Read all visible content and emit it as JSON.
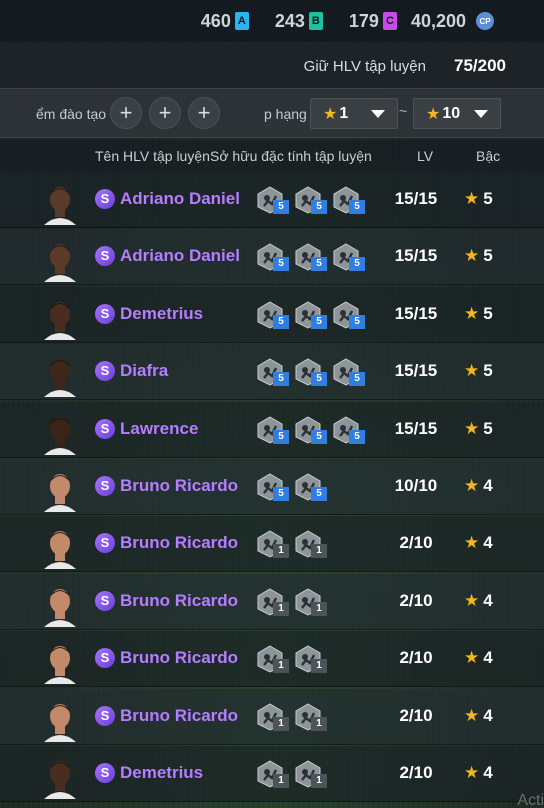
{
  "currencies": [
    {
      "value": "460",
      "badge": "A",
      "color": "#2ab5f0"
    },
    {
      "value": "243",
      "badge": "B",
      "color": "#1fc1a0"
    },
    {
      "value": "179",
      "badge": "C",
      "color": "#c94ce8"
    },
    {
      "value": "40,200",
      "badge": "CP",
      "color": "#5e8fd6"
    }
  ],
  "hold": {
    "label": "Giữ HLV tập luyện",
    "value": "75/200"
  },
  "filter": {
    "training_label": "ểm đào tạo",
    "rank_label": "p hạng",
    "rank_from": "1",
    "rank_to": "10",
    "separator": "~",
    "plus": "+"
  },
  "columns": {
    "name": "Tên HLV tập luyện",
    "traits": "Sở hữu đặc tính tập luyện",
    "lv": "LV",
    "grade": "Bậc"
  },
  "badge_letter": "S",
  "coaches": [
    {
      "name": "Adriano Daniel",
      "lv": "15/15",
      "grade": "5",
      "traits": [
        {
          "icon": "ball-control-icon",
          "level": "5"
        },
        {
          "icon": "dribble-icon",
          "level": "5"
        },
        {
          "icon": "sprint-icon",
          "level": "5"
        }
      ],
      "skin": "#5a3a28"
    },
    {
      "name": "Adriano Daniel",
      "lv": "15/15",
      "grade": "5",
      "traits": [
        {
          "icon": "tackle-icon",
          "level": "5"
        },
        {
          "icon": "dribble-icon",
          "level": "5"
        },
        {
          "icon": "header-icon",
          "level": "5"
        }
      ],
      "skin": "#5a3a28"
    },
    {
      "name": "Demetrius",
      "lv": "15/15",
      "grade": "5",
      "traits": [
        {
          "icon": "strength-icon",
          "level": "5"
        },
        {
          "icon": "stamina-icon",
          "level": "5"
        },
        {
          "icon": "jump-icon",
          "level": "5"
        }
      ],
      "skin": "#4a2d1e"
    },
    {
      "name": "Diafra",
      "lv": "15/15",
      "grade": "5",
      "traits": [
        {
          "icon": "strength-icon",
          "level": "5"
        },
        {
          "icon": "stamina-icon",
          "level": "5"
        },
        {
          "icon": "jump-icon",
          "level": "5"
        }
      ],
      "skin": "#3f261a"
    },
    {
      "name": "Lawrence",
      "lv": "15/15",
      "grade": "5",
      "traits": [
        {
          "icon": "shooting-icon",
          "level": "5"
        },
        {
          "icon": "passing-icon",
          "level": "5"
        },
        {
          "icon": "jump-icon",
          "level": "5"
        }
      ],
      "skin": "#3a2418"
    },
    {
      "name": "Bruno Ricardo",
      "lv": "10/10",
      "grade": "4",
      "traits": [
        {
          "icon": "tackle-icon",
          "level": "5"
        },
        {
          "icon": "strength-icon",
          "level": "5"
        }
      ],
      "skin": "#c28a6a"
    },
    {
      "name": "Bruno Ricardo",
      "lv": "2/10",
      "grade": "4",
      "traits": [
        {
          "icon": "tackle-icon",
          "level": "1"
        },
        {
          "icon": "strength-icon",
          "level": "1"
        }
      ],
      "skin": "#c28a6a"
    },
    {
      "name": "Bruno Ricardo",
      "lv": "2/10",
      "grade": "4",
      "traits": [
        {
          "icon": "tackle-icon",
          "level": "1"
        },
        {
          "icon": "strength-icon",
          "level": "1"
        }
      ],
      "skin": "#c28a6a"
    },
    {
      "name": "Bruno Ricardo",
      "lv": "2/10",
      "grade": "4",
      "traits": [
        {
          "icon": "dribble-icon",
          "level": "1"
        },
        {
          "icon": "strength-icon",
          "level": "1"
        }
      ],
      "skin": "#c28a6a"
    },
    {
      "name": "Bruno Ricardo",
      "lv": "2/10",
      "grade": "4",
      "traits": [
        {
          "icon": "dribble-icon",
          "level": "1"
        },
        {
          "icon": "strength-icon",
          "level": "1"
        }
      ],
      "skin": "#c28a6a"
    },
    {
      "name": "Demetrius",
      "lv": "2/10",
      "grade": "4",
      "traits": [
        {
          "icon": "ball-control-icon",
          "level": "1"
        },
        {
          "icon": "sprint-icon",
          "level": "1"
        }
      ],
      "skin": "#4a2d1e"
    }
  ],
  "colors": {
    "accent_level": "#2f7ee0",
    "name_purple": "#b57dff",
    "star_gold": "#f1b621"
  },
  "watermark": "Activ"
}
